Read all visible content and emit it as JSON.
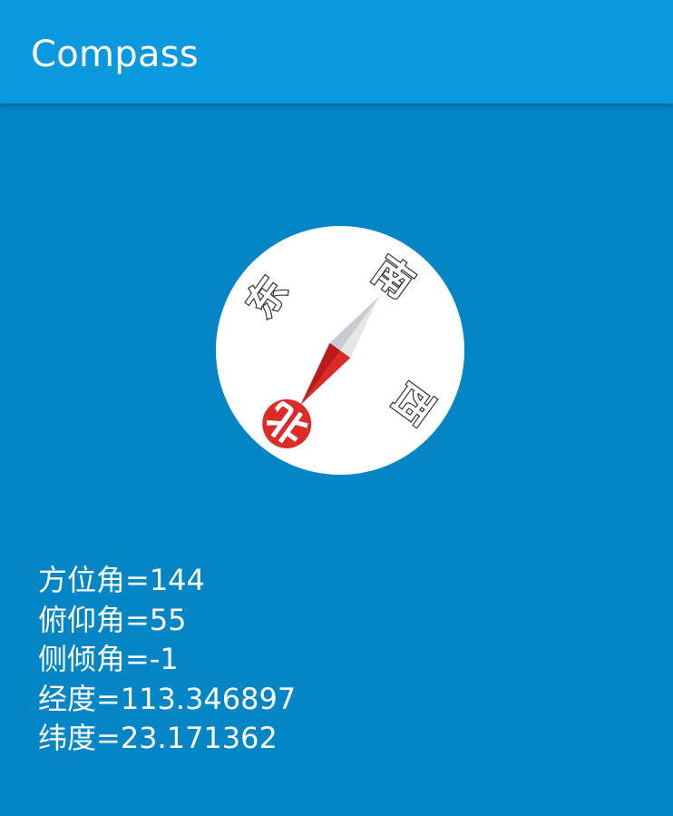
{
  "app_bar": {
    "title": "Compass",
    "background": "#0a99df"
  },
  "screen": {
    "background": "#0485c6"
  },
  "compass": {
    "azimuth": 144,
    "directions": {
      "north": "北",
      "south": "南",
      "east": "东",
      "west": "西"
    },
    "colors": {
      "dial": "#ffffff",
      "needle_red": "#dd2b27",
      "needle_dark_red": "#b91b1b",
      "needle_grey": "#d0d3d6",
      "north_badge": "#dd2b27"
    }
  },
  "readings": [
    "方位角=144",
    "俯仰角=55",
    "侧倾角=-1",
    "经度=113.346897",
    "纬度=23.171362"
  ]
}
